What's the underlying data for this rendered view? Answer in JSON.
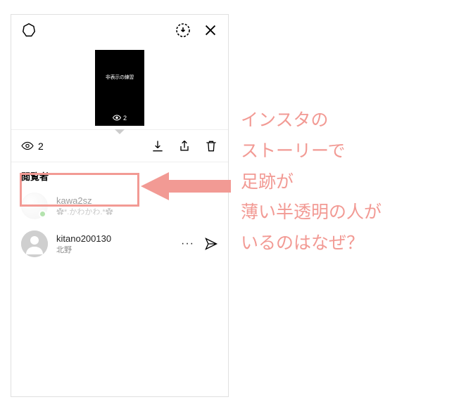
{
  "topbar": {},
  "story_thumb": {
    "caption": "非表示の練習",
    "view_count": "2"
  },
  "action_bar": {
    "view_count": "2"
  },
  "viewers": {
    "section_title": "閲覧者",
    "items": [
      {
        "username": "kawa2sz",
        "subtitle": "✿*.かわかわ.*✿",
        "online": true,
        "faded": true
      },
      {
        "username": "kitano200130",
        "subtitle": "北野",
        "online": false,
        "faded": false
      }
    ]
  },
  "annotation": {
    "lines": [
      "インスタの",
      "ストーリーで",
      "足跡が",
      "薄い半透明の人が",
      "いるのはなぜ？"
    ]
  },
  "colors": {
    "accent": "#f29a94"
  }
}
